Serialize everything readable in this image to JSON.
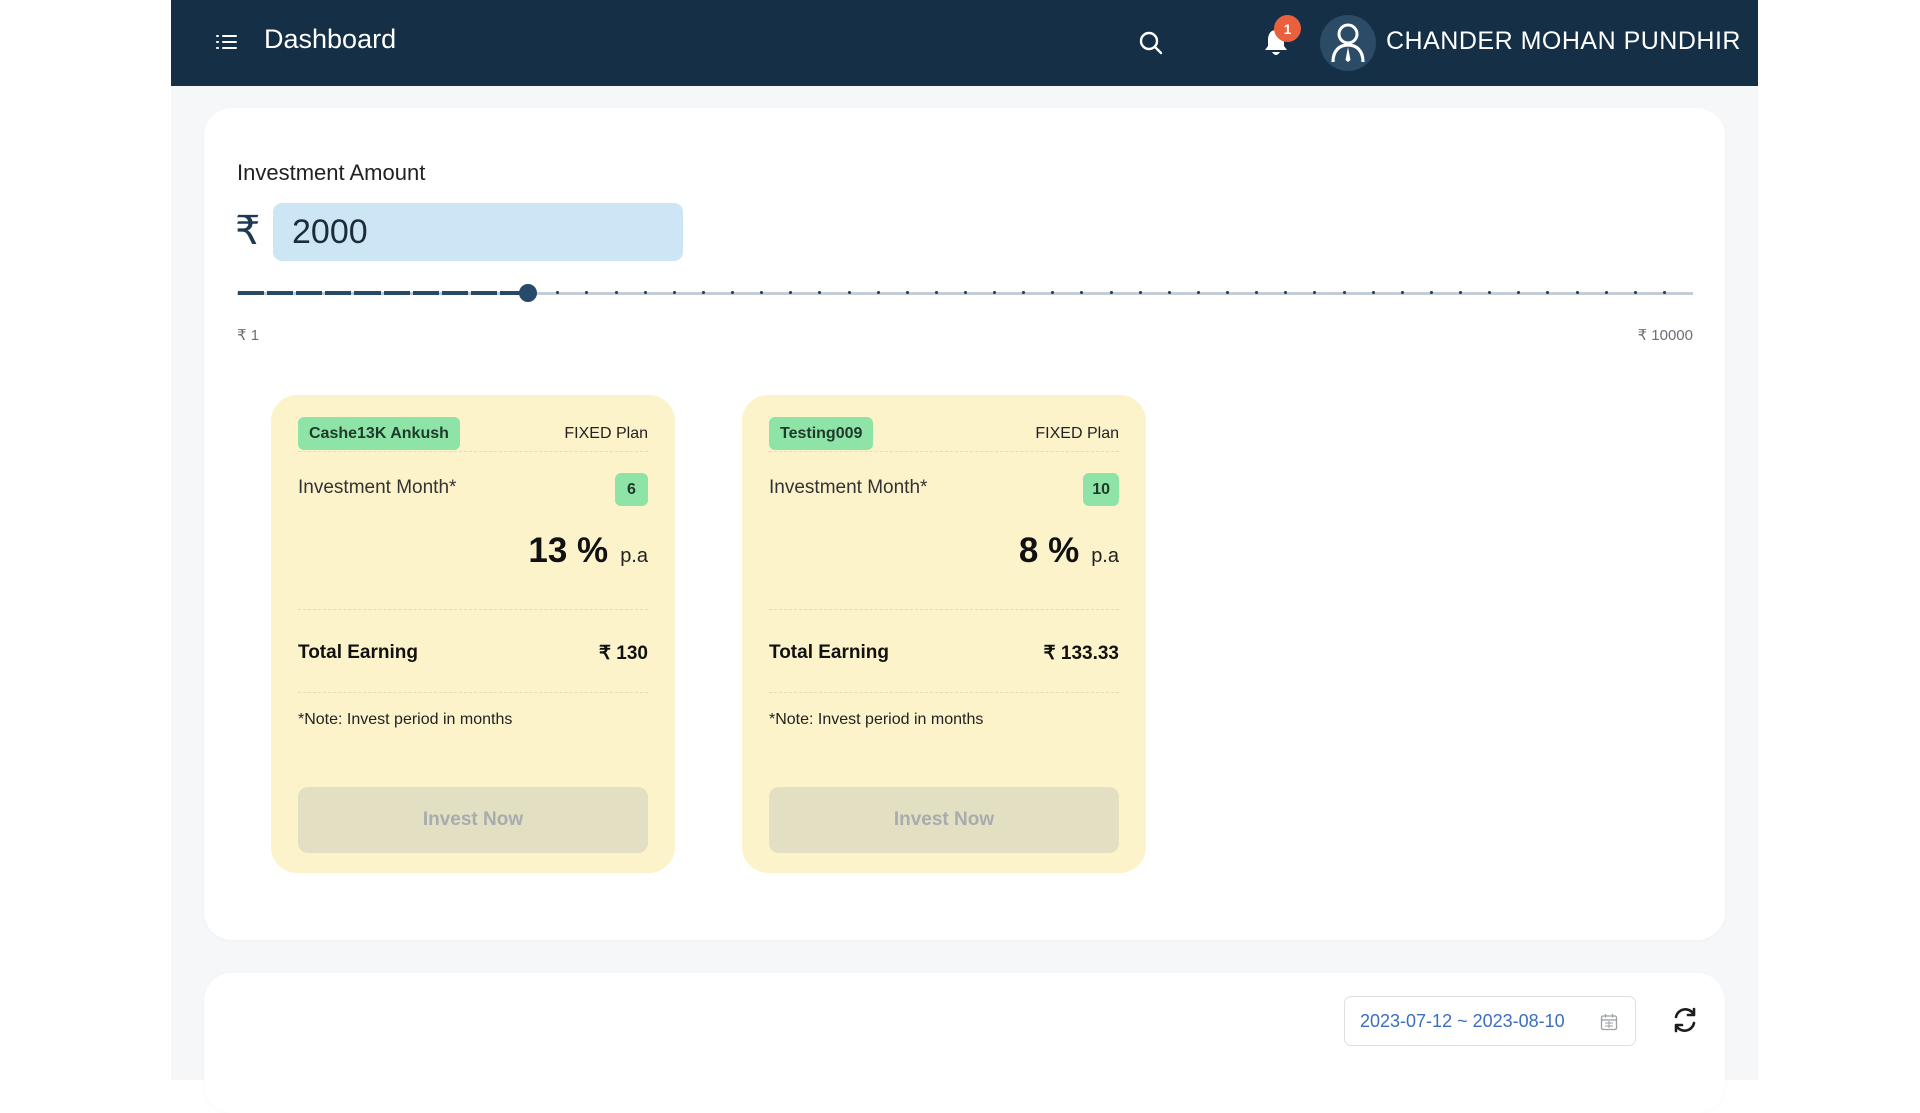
{
  "header": {
    "title": "Dashboard",
    "notification_count": "1",
    "username": "CHANDER MOHAN PUNDHIR",
    "icons": {
      "menu": "menu-icon",
      "search": "search-icon",
      "bell": "bell-icon",
      "avatar": "user-avatar-icon"
    }
  },
  "investment": {
    "label": "Investment Amount",
    "currency_symbol": "₹",
    "amount": "2000",
    "slider": {
      "min": 1,
      "max": 10000,
      "step": 200,
      "value": 2000,
      "min_label": "₹ 1",
      "max_label": "₹ 10000"
    }
  },
  "plans": [
    {
      "name": "Cashe13K Ankush",
      "type": "FIXED Plan",
      "month_label": "Investment Month*",
      "months": "6",
      "rate": "13 %",
      "rate_unit": "p.a",
      "earning_label": "Total Earning",
      "earning": "₹ 130",
      "note": "*Note: Invest period in months",
      "button": "Invest Now"
    },
    {
      "name": "Testing009",
      "type": "FIXED Plan",
      "month_label": "Investment Month*",
      "months": "10",
      "rate": "8 %",
      "rate_unit": "p.a",
      "earning_label": "Total Earning",
      "earning": "₹ 133.33",
      "note": "*Note: Invest period in months",
      "button": "Invest Now"
    }
  ],
  "filters": {
    "date_range": "2023-07-12 ~ 2023-08-10",
    "icons": {
      "calendar": "calendar-icon",
      "refresh": "refresh-icon"
    }
  },
  "colors": {
    "header_bg": "#142f46",
    "plan_card_bg": "#fdf3cb",
    "tag_green": "#8ee3a7",
    "badge_red": "#e8603d",
    "input_bg": "#cce6f6",
    "date_text": "#3a6fbf"
  }
}
